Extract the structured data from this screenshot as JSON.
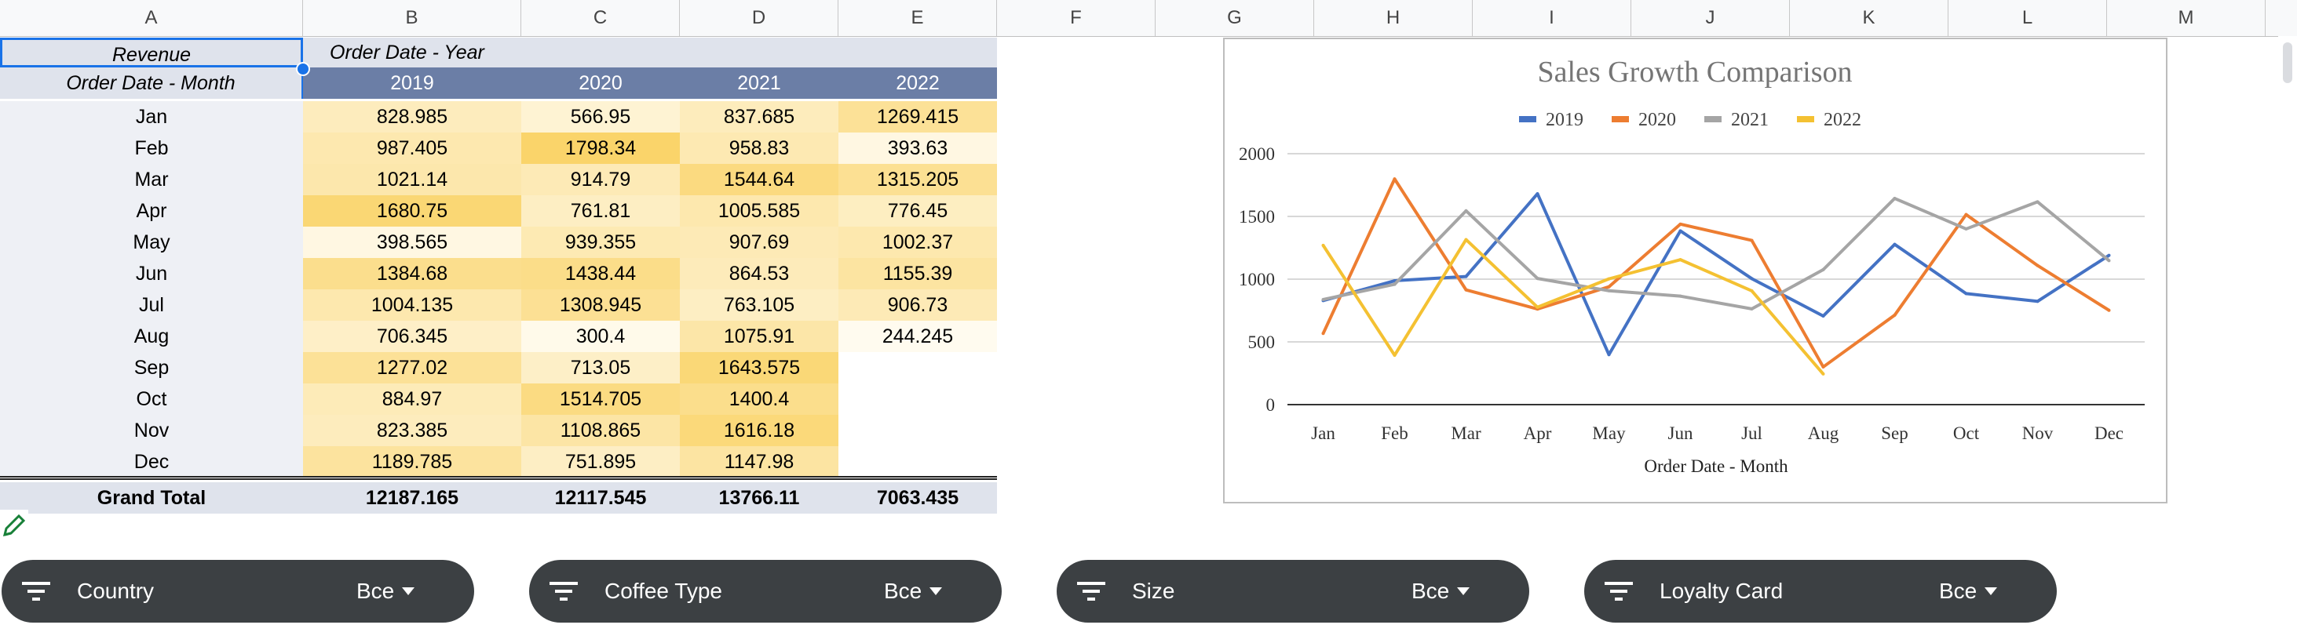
{
  "columns": [
    "A",
    "B",
    "C",
    "D",
    "E",
    "F",
    "G",
    "H",
    "I",
    "J",
    "K",
    "L",
    "M"
  ],
  "pivot": {
    "value_label": "Revenue",
    "column_field": "Order Date - Year",
    "row_field": "Order Date - Month",
    "years": [
      "2019",
      "2020",
      "2021",
      "2022"
    ],
    "rows": [
      {
        "month": "Jan",
        "values": [
          "828.985",
          "566.95",
          "837.685",
          "1269.415"
        ]
      },
      {
        "month": "Feb",
        "values": [
          "987.405",
          "1798.34",
          "958.83",
          "393.63"
        ]
      },
      {
        "month": "Mar",
        "values": [
          "1021.14",
          "914.79",
          "1544.64",
          "1315.205"
        ]
      },
      {
        "month": "Apr",
        "values": [
          "1680.75",
          "761.81",
          "1005.585",
          "776.45"
        ]
      },
      {
        "month": "May",
        "values": [
          "398.565",
          "939.355",
          "907.69",
          "1002.37"
        ]
      },
      {
        "month": "Jun",
        "values": [
          "1384.68",
          "1438.44",
          "864.53",
          "1155.39"
        ]
      },
      {
        "month": "Jul",
        "values": [
          "1004.135",
          "1308.945",
          "763.105",
          "906.73"
        ]
      },
      {
        "month": "Aug",
        "values": [
          "706.345",
          "300.4",
          "1075.91",
          "244.245"
        ]
      },
      {
        "month": "Sep",
        "values": [
          "1277.02",
          "713.05",
          "1643.575",
          ""
        ]
      },
      {
        "month": "Oct",
        "values": [
          "884.97",
          "1514.705",
          "1400.4",
          ""
        ]
      },
      {
        "month": "Nov",
        "values": [
          "823.385",
          "1108.865",
          "1616.18",
          ""
        ]
      },
      {
        "month": "Dec",
        "values": [
          "1189.785",
          "751.895",
          "1147.98",
          ""
        ]
      }
    ],
    "grand_total_label": "Grand Total",
    "grand_totals": [
      "12187.165",
      "12117.545",
      "13766.11",
      "7063.435"
    ]
  },
  "chart_data": {
    "type": "line",
    "title": "Sales Growth Comparison",
    "xlabel": "Order Date - Month",
    "ylabel": "",
    "categories": [
      "Jan",
      "Feb",
      "Mar",
      "Apr",
      "May",
      "Jun",
      "Jul",
      "Aug",
      "Sep",
      "Oct",
      "Nov",
      "Dec"
    ],
    "ylim": [
      0,
      2000
    ],
    "yticks": [
      "0",
      "500",
      "1000",
      "1500",
      "2000"
    ],
    "grid": true,
    "legend": "top",
    "series": [
      {
        "name": "2019",
        "color": "#4472c4",
        "values": [
          828.985,
          987.405,
          1021.14,
          1680.75,
          398.565,
          1384.68,
          1004.135,
          706.345,
          1277.02,
          884.97,
          823.385,
          1189.785
        ]
      },
      {
        "name": "2020",
        "color": "#ed7d31",
        "values": [
          566.95,
          1798.34,
          914.79,
          761.81,
          939.355,
          1438.44,
          1308.945,
          300.4,
          713.05,
          1514.705,
          1108.865,
          751.895
        ]
      },
      {
        "name": "2021",
        "color": "#a5a5a5",
        "values": [
          837.685,
          958.83,
          1544.64,
          1005.585,
          907.69,
          864.53,
          763.105,
          1075.91,
          1643.575,
          1400.4,
          1616.18,
          1147.98
        ]
      },
      {
        "name": "2022",
        "color": "#f4c132",
        "values": [
          1269.415,
          393.63,
          1315.205,
          776.45,
          1002.37,
          1155.39,
          906.73,
          244.245
        ]
      }
    ]
  },
  "filters": [
    {
      "label": "Country",
      "value": "Все"
    },
    {
      "label": "Coffee Type",
      "value": "Все"
    },
    {
      "label": "Size",
      "value": "Все"
    },
    {
      "label": "Loyalty Card",
      "value": "Все"
    }
  ],
  "colors": {
    "header_blue": "#6b7ea6",
    "label_bg": "#dfe3ec",
    "heat_low": "#fffbef",
    "heat_high": "#fad46a",
    "filter_bg": "#3c4043",
    "edit_green": "#188038"
  }
}
